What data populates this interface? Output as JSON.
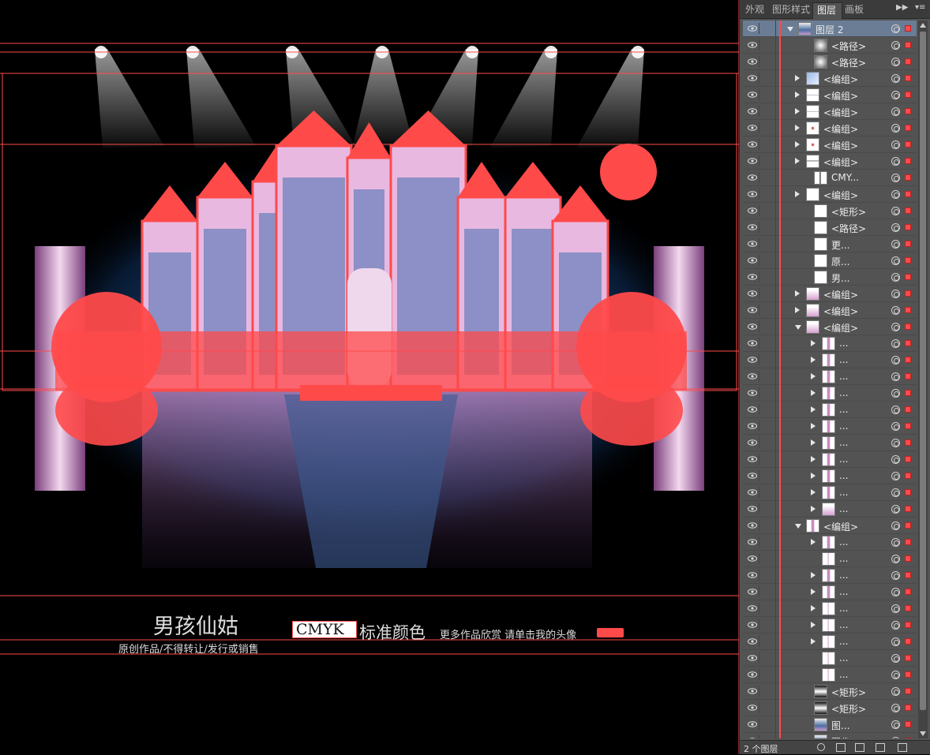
{
  "panel": {
    "tabs": [
      {
        "label": "外观",
        "active": false
      },
      {
        "label": "图形样式",
        "active": false
      },
      {
        "label": "图层",
        "active": true
      },
      {
        "label": "画板",
        "active": false
      }
    ],
    "status": "2 个图层",
    "layers": [
      {
        "name": "图层 2",
        "indent": 0,
        "twisty": "open",
        "thumb": "scene",
        "sel": true
      },
      {
        "name": "<路径>",
        "indent": 2,
        "twisty": "none",
        "thumb": "glow"
      },
      {
        "name": "<路径>",
        "indent": 2,
        "twisty": "none",
        "thumb": "glow"
      },
      {
        "name": "<编组>",
        "indent": 1,
        "twisty": "closed",
        "thumb": "blue"
      },
      {
        "name": "<编组>",
        "indent": 1,
        "twisty": "closed",
        "thumb": "line"
      },
      {
        "name": "<编组>",
        "indent": 1,
        "twisty": "closed",
        "thumb": "line"
      },
      {
        "name": "<编组>",
        "indent": 1,
        "twisty": "closed",
        "thumb": "dot"
      },
      {
        "name": "<编组>",
        "indent": 1,
        "twisty": "closed",
        "thumb": "dot"
      },
      {
        "name": "<编组>",
        "indent": 1,
        "twisty": "closed",
        "thumb": "text"
      },
      {
        "name": "CMY...",
        "indent": 2,
        "twisty": "none",
        "thumb": "mono"
      },
      {
        "name": "<编组>",
        "indent": 1,
        "twisty": "closed",
        "thumb": "white"
      },
      {
        "name": "<矩形>",
        "indent": 2,
        "twisty": "none",
        "thumb": "white"
      },
      {
        "name": "<路径>",
        "indent": 2,
        "twisty": "none",
        "thumb": "white"
      },
      {
        "name": "更...",
        "indent": 2,
        "twisty": "none",
        "thumb": "white"
      },
      {
        "name": "原...",
        "indent": 2,
        "twisty": "none",
        "thumb": "white"
      },
      {
        "name": "男...",
        "indent": 2,
        "twisty": "none",
        "thumb": "white"
      },
      {
        "name": "<编组>",
        "indent": 1,
        "twisty": "closed",
        "thumb": "pink"
      },
      {
        "name": "<编组>",
        "indent": 1,
        "twisty": "closed",
        "thumb": "pink"
      },
      {
        "name": "<编组>",
        "indent": 1,
        "twisty": "open",
        "thumb": "pink"
      },
      {
        "name": "...",
        "indent": 3,
        "twisty": "closed",
        "thumb": "tall"
      },
      {
        "name": "...",
        "indent": 3,
        "twisty": "closed",
        "thumb": "tall"
      },
      {
        "name": "...",
        "indent": 3,
        "twisty": "closed",
        "thumb": "tall"
      },
      {
        "name": "...",
        "indent": 3,
        "twisty": "closed",
        "thumb": "tall"
      },
      {
        "name": "...",
        "indent": 3,
        "twisty": "closed",
        "thumb": "tall"
      },
      {
        "name": "...",
        "indent": 3,
        "twisty": "closed",
        "thumb": "tall"
      },
      {
        "name": "...",
        "indent": 3,
        "twisty": "closed",
        "thumb": "tall"
      },
      {
        "name": "...",
        "indent": 3,
        "twisty": "closed",
        "thumb": "tall"
      },
      {
        "name": "...",
        "indent": 3,
        "twisty": "closed",
        "thumb": "tall"
      },
      {
        "name": "...",
        "indent": 3,
        "twisty": "closed",
        "thumb": "tall"
      },
      {
        "name": "...",
        "indent": 3,
        "twisty": "closed",
        "thumb": "pink"
      },
      {
        "name": "<编组>",
        "indent": 1,
        "twisty": "open",
        "thumb": "tall"
      },
      {
        "name": "...",
        "indent": 3,
        "twisty": "closed",
        "thumb": "tall"
      },
      {
        "name": "...",
        "indent": 3,
        "twisty": "none",
        "thumb": "spire"
      },
      {
        "name": "...",
        "indent": 3,
        "twisty": "closed",
        "thumb": "tall"
      },
      {
        "name": "...",
        "indent": 3,
        "twisty": "closed",
        "thumb": "tall"
      },
      {
        "name": "...",
        "indent": 3,
        "twisty": "closed",
        "thumb": "spire"
      },
      {
        "name": "...",
        "indent": 3,
        "twisty": "closed",
        "thumb": "spire"
      },
      {
        "name": "...",
        "indent": 3,
        "twisty": "closed",
        "thumb": "spire"
      },
      {
        "name": "...",
        "indent": 3,
        "twisty": "none",
        "thumb": "spire"
      },
      {
        "name": "...",
        "indent": 3,
        "twisty": "none",
        "thumb": "spire"
      },
      {
        "name": "<矩形>",
        "indent": 2,
        "twisty": "none",
        "thumb": "gradient"
      },
      {
        "name": "<矩形>",
        "indent": 2,
        "twisty": "none",
        "thumb": "gradient"
      },
      {
        "name": "图...",
        "indent": 2,
        "twisty": "none",
        "thumb": "scene"
      },
      {
        "name": "图像",
        "indent": 2,
        "twisty": "none",
        "thumb": "scene"
      }
    ]
  },
  "artboard": {
    "title": "男孩仙姑",
    "cmyk_label": "CMYK",
    "standard_color": "标准颜色",
    "more_works": "更多作品欣赏 请单击我的头像",
    "notice": "原创作品/不得转让/发行或销售",
    "selection_color": "#ff4a4a",
    "sky_color": "#1d4f86"
  }
}
